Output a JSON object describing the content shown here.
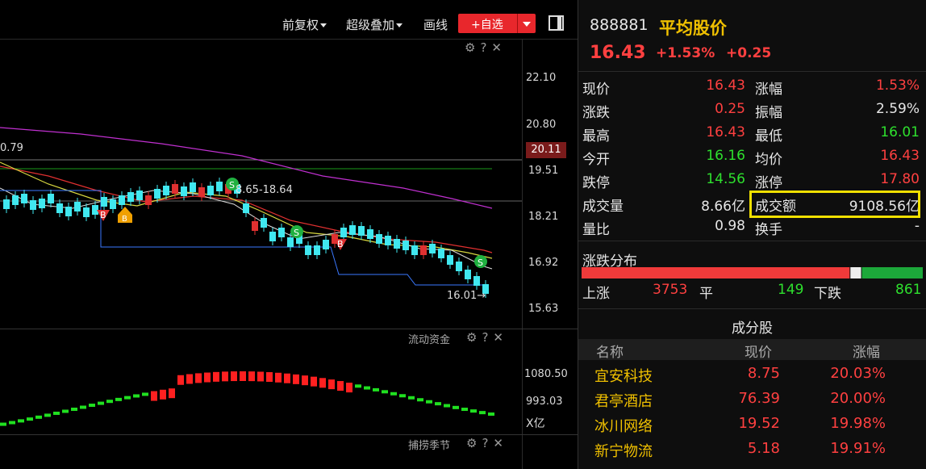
{
  "toolbar": {
    "adjust_label": "前复权",
    "overlay_label": "超级叠加",
    "draw_label": "画线",
    "add_watch_label": "+自选"
  },
  "chart": {
    "price_axis": [
      "22.10",
      "20.80",
      "19.51",
      "18.21",
      "16.92",
      "15.63"
    ],
    "crosshair_price": "20.11",
    "left_value": "0.79",
    "range_annotation": "8.65-18.64",
    "low_annotation": "16.01",
    "flow_title": "流动资金",
    "flow_axis": [
      "1080.50",
      "993.03"
    ],
    "flow_unit": "X亿",
    "season_title": "捕捞季节",
    "markers": [
      "B",
      "B",
      "S",
      "S",
      "B",
      "S"
    ]
  },
  "quote": {
    "code": "888881",
    "name": "平均股价",
    "price": "16.43",
    "change_pct": "+1.53%",
    "change": "+0.25",
    "rows": [
      {
        "k1": "现价",
        "v1": "16.43",
        "c1": "red",
        "k2": "涨幅",
        "v2": "1.53%",
        "c2": "red"
      },
      {
        "k1": "涨跌",
        "v1": "0.25",
        "c1": "red",
        "k2": "振幅",
        "v2": "2.59%",
        "c2": "white"
      },
      {
        "k1": "最高",
        "v1": "16.43",
        "c1": "red",
        "k2": "最低",
        "v2": "16.01",
        "c2": "green"
      },
      {
        "k1": "今开",
        "v1": "16.16",
        "c1": "green",
        "k2": "均价",
        "v2": "16.43",
        "c2": "red"
      },
      {
        "k1": "跌停",
        "v1": "14.56",
        "c1": "green",
        "k2": "涨停",
        "v2": "17.80",
        "c2": "red"
      },
      {
        "k1": "成交量",
        "v1": "8.66亿",
        "c1": "white",
        "k2": "成交额",
        "v2": "9108.56亿",
        "c2": "white"
      },
      {
        "k1": "量比",
        "v1": "0.98",
        "c1": "white",
        "k2": "换手",
        "v2": "-",
        "c2": "white"
      }
    ],
    "distribution": {
      "title": "涨跌分布",
      "up_label": "上涨",
      "up_count": "3753",
      "flat_label": "平",
      "flat_count": "149",
      "down_label": "下跌",
      "down_count": "861"
    },
    "components": {
      "title": "成分股",
      "headers": [
        "名称",
        "现价",
        "涨幅"
      ],
      "rows": [
        {
          "name": "宜安科技",
          "price": "8.75",
          "chg": "20.03%"
        },
        {
          "name": "君亭酒店",
          "price": "76.39",
          "chg": "20.00%"
        },
        {
          "name": "冰川网络",
          "price": "19.52",
          "chg": "19.98%"
        },
        {
          "name": "新宁物流",
          "price": "5.18",
          "chg": "19.91%"
        }
      ]
    }
  },
  "colors": {
    "up": "#ff4040",
    "down": "#2ee02e",
    "accent": "#f0c000",
    "highlight": "#f0e000"
  }
}
